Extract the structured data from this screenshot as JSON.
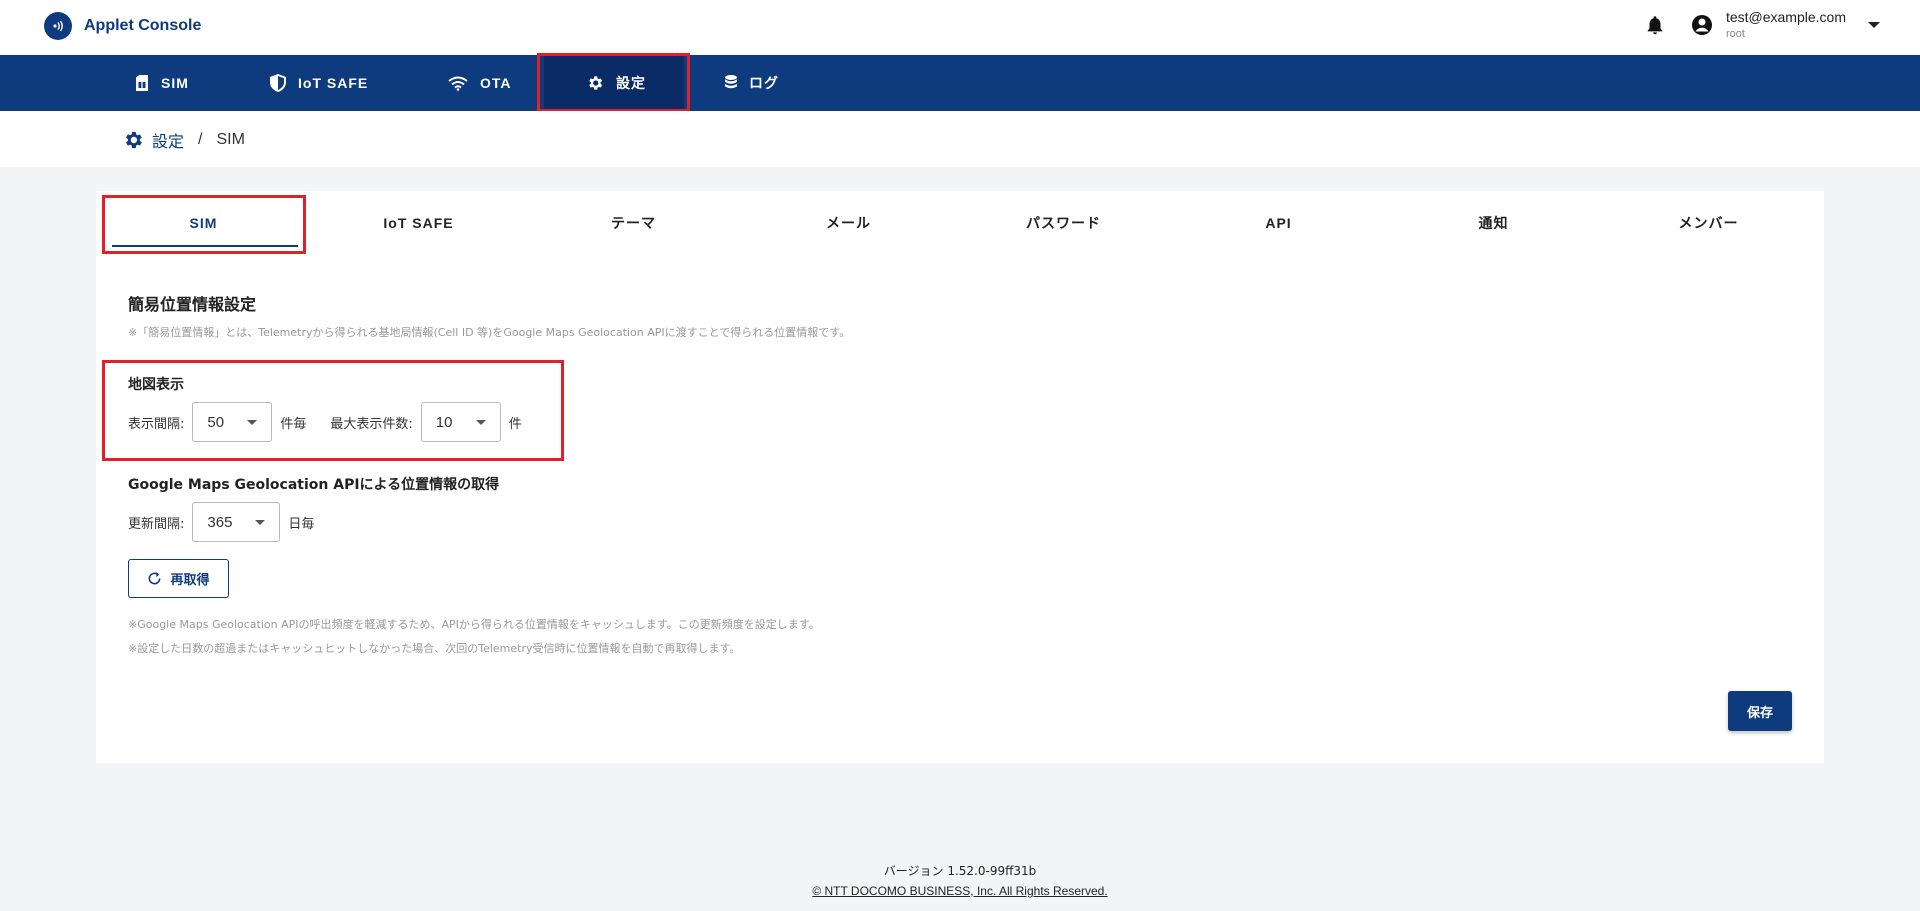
{
  "app": {
    "title": "Applet Console"
  },
  "user": {
    "email": "test@example.com",
    "role": "root"
  },
  "nav": {
    "items": [
      {
        "label": "SIM",
        "icon": "sim-card-icon"
      },
      {
        "label": "IoT SAFE",
        "icon": "shield-icon"
      },
      {
        "label": "OTA",
        "icon": "wifi-icon"
      },
      {
        "label": "設定",
        "icon": "gear-icon",
        "active": true
      },
      {
        "label": "ログ",
        "icon": "database-icon"
      }
    ]
  },
  "breadcrumb": {
    "parent": "設定",
    "separator": "/",
    "current": "SIM"
  },
  "tabs": [
    "SIM",
    "IoT SAFE",
    "テーマ",
    "メール",
    "パスワード",
    "API",
    "通知",
    "メンバー"
  ],
  "section": {
    "title": "簡易位置情報設定",
    "note": "※「簡易位置情報」とは、Telemetryから得られる基地局情報(Cell ID 等)をGoogle Maps Geolocation APIに渡すことで得られる位置情報です。",
    "map": {
      "title": "地図表示",
      "interval_label": "表示間隔:",
      "interval_value": "50",
      "interval_unit": "件毎",
      "max_label": "最大表示件数:",
      "max_value": "10",
      "max_unit": "件"
    },
    "geo": {
      "title": "Google Maps Geolocation APIによる位置情報の取得",
      "update_label": "更新間隔:",
      "update_value": "365",
      "update_unit": "日毎",
      "refetch_label": "再取得",
      "note1": "※Google Maps Geolocation APIの呼出頻度を軽減するため、APIから得られる位置情報をキャッシュします。この更新頻度を設定します。",
      "note2": "※設定した日数の超過またはキャッシュヒットしなかった場合、次回のTelemetry受信時に位置情報を自動で再取得します。"
    },
    "save_label": "保存"
  },
  "footer": {
    "version": "バージョン 1.52.0-99ff31b",
    "copyright": "© NTT DOCOMO BUSINESS, Inc. All Rights Reserved."
  },
  "colors": {
    "brand": "#0e3a7e",
    "highlight": "#e0202a"
  }
}
